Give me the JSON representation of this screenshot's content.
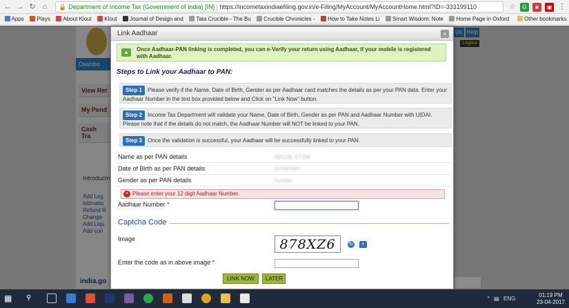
{
  "browser": {
    "secure_label": "Department of Income Tax (Government of India) [IN]",
    "url": "https://incometaxindiaefiling.gov.in/e-Filing/MyAccount/MyAccountHome.html?ID=-333199110",
    "bookmarks": [
      {
        "label": "Apps",
        "color": "#4a7ad8"
      },
      {
        "label": "Plays",
        "color": "#e05020"
      },
      {
        "label": "About Klout",
        "color": "#e04040"
      },
      {
        "label": "Klout",
        "color": "#e04040"
      },
      {
        "label": "Journal of Design and",
        "color": "#333333"
      },
      {
        "label": "Tata Crucible - The Bu",
        "color": "#888888"
      },
      {
        "label": "Crucible Chronicles -",
        "color": "#888888"
      },
      {
        "label": "How to Take Notes Li",
        "color": "#c04040"
      },
      {
        "label": "Smart Wisdom: Note",
        "color": "#888888"
      },
      {
        "label": "Home Page in Oxford",
        "color": "#888888"
      }
    ],
    "other_bookmarks": "Other bookmarks"
  },
  "background_page": {
    "dashboard_tab": "Dashbo",
    "side_items": [
      "View Ret",
      "My Pend",
      "Cash Tra"
    ],
    "introducing": "Introducin",
    "list_items": [
      "Add Leg",
      "Intimatio",
      "Refund R",
      "Change",
      "Add Liqu",
      "Add con"
    ],
    "top_right": [
      "Us",
      "Help",
      "Logout"
    ],
    "footer_logo": "india.go"
  },
  "modal": {
    "title": "Link Aadhaar",
    "notice": "Once Aadhaar-PAN linking is completed, you can e-Verify your return using Aadhaar, if your mobile is registered with Aadhaar.",
    "steps_title": "Steps to Link your Aadhaar to PAN:",
    "steps": [
      {
        "badge": "Step 1",
        "text": "Please verify if the Name, Date of Birth, Gender as per Aadhaar card matches the details as per your PAN data. Enter your Aadhaar Number in the text box provided below and Click on \"Link Now\" button."
      },
      {
        "badge": "Step 2",
        "text": "Income Tax Department will validate your Name, Date of Birth, Gender as per PAN and Aadhaar Number with UIDAI. Please note that if the details do not match, the Aadhaar Number will NOT be linked to your PAN."
      },
      {
        "badge": "Step 3",
        "text": "Once the validation is successful, your Aadhaar will be successfully linked to your PAN."
      }
    ],
    "fields": {
      "name_label": "Name as per PAN details",
      "name_value": "ABCDE XYZW",
      "dob_label": "Date of Birth as per PAN details",
      "dob_value": "11/09/1997",
      "gender_label": "Gender as per PAN details",
      "gender_value": "Female"
    },
    "error": "Please enter your 12 digit Aadhaar Number.",
    "aadhaar_label": "Aadhaar Number",
    "required_mark": "*",
    "captcha_section": "Captcha Code",
    "image_label": "Image",
    "captcha_text": "878XZ6",
    "code_label": "Enter the code as in above image",
    "link_now": "LINK NOW",
    "later": "LATER"
  },
  "taskbar": {
    "lang": "ENG",
    "time": "01:19 PM",
    "date": "23-04-2017"
  }
}
